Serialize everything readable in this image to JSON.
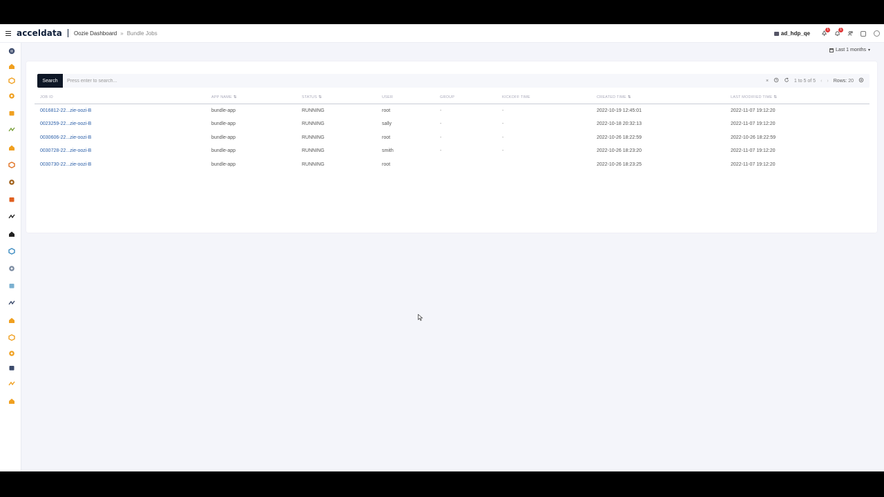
{
  "header": {
    "logo": "acceldata",
    "breadcrumb": {
      "parent": "Oozie Dashboard",
      "separator": "»",
      "current": "Bundle Jobs"
    },
    "cluster": "ad_hdp_qe",
    "notification_badges": [
      "1",
      "1"
    ]
  },
  "filter": {
    "date_range": "Last 1 months"
  },
  "search": {
    "button_label": "Search",
    "placeholder": "Press enter to search...",
    "clear": "×",
    "pagination_text": "1 to 5 of 5",
    "prev": "‹",
    "next": "›",
    "rows_label": "Rows:",
    "rows_value": "20"
  },
  "table": {
    "columns": [
      "JOB ID",
      "APP NAME",
      "STATUS",
      "USER",
      "GROUP",
      "KICKOFF TIME",
      "CREATED TIME",
      "LAST MODIFIED TIME"
    ],
    "sortable": [
      false,
      true,
      true,
      false,
      false,
      false,
      true,
      true
    ],
    "rows": [
      [
        "0016812-22...zie-oozi-B",
        "bundle-app",
        "RUNNING",
        "root",
        "-",
        "-",
        "2022-10-19 12:45:01",
        "2022-11-07 19:12:20"
      ],
      [
        "0023259-22...zie-oozi-B",
        "bundle-app",
        "RUNNING",
        "sally",
        "-",
        "-",
        "2022-10-18 20:32:13",
        "2022-11-07 19:12:20"
      ],
      [
        "0030606-22...zie-oozi-B",
        "bundle-app",
        "RUNNING",
        "root",
        "-",
        "-",
        "2022-10-26 18:22:59",
        "2022-10-26 18:22:59"
      ],
      [
        "0030728-22...zie-oozi-B",
        "bundle-app",
        "RUNNING",
        "smith",
        "-",
        "-",
        "2022-10-26 18:23:20",
        "2022-11-07 19:12:20"
      ],
      [
        "0030730-22...zie-oozi-B",
        "bundle-app",
        "RUNNING",
        "root",
        "",
        "",
        "2022-10-26 18:23:25",
        "2022-11-07 19:12:20"
      ]
    ]
  },
  "sidebar_icons": [
    {
      "name": "menu-circle-icon",
      "color": "#3b4a6b"
    },
    {
      "name": "home-icon",
      "color": "#f0a020"
    },
    {
      "name": "cube-icon",
      "color": "#f0a020"
    },
    {
      "name": "layers-icon",
      "color": "#f0a020"
    },
    {
      "name": "hadoop-elephant-icon",
      "color": "#f0a020"
    },
    {
      "name": "yarn-icon",
      "color": "#7aa03a"
    },
    {
      "name": "hive-icon",
      "color": "#f0a020"
    },
    {
      "name": "spark-icon",
      "color": "#e07020"
    },
    {
      "name": "hbase-icon",
      "color": "#a0601a"
    },
    {
      "name": "trend-icon",
      "color": "#e06020"
    },
    {
      "name": "kafka-icon",
      "color": "#222222"
    },
    {
      "name": "network-icon",
      "color": "#222222"
    },
    {
      "name": "zookeeper-icon",
      "color": "#3a8ac0"
    },
    {
      "name": "druid-icon",
      "color": "#7a8aa0"
    },
    {
      "name": "wave-icon",
      "color": "#7ab0d0"
    },
    {
      "name": "oozie-icon",
      "color": "#3b4a6b"
    },
    {
      "name": "report-icon",
      "color": "#f0a020"
    },
    {
      "name": "database-icon",
      "color": "#f0a020"
    },
    {
      "name": "grid-icon",
      "color": "#f0a020"
    },
    {
      "name": "server-icon",
      "color": "#3b4a6b"
    },
    {
      "name": "bell-icon",
      "color": "#f0a020"
    },
    {
      "name": "command-icon",
      "color": "#f0a020"
    }
  ]
}
